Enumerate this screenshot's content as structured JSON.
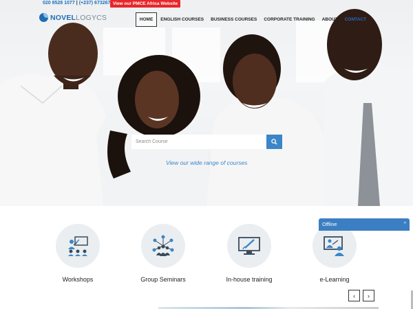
{
  "topbar": {
    "phone1": "020 8528 1077",
    "phone2": "(+237) 673267414",
    "pmce_link": "View our PMCE Africa Website"
  },
  "logo": {
    "part1": "NOVEL",
    "part2": "LOGYCS"
  },
  "nav": {
    "items": [
      "HOME",
      "ENGLISH COURSES",
      "BUSINESS COURSES",
      "CORPORATE TRAINING",
      "ABOUT",
      "CONTACT"
    ],
    "active": "HOME"
  },
  "search": {
    "placeholder": "Search Course",
    "tagline": "View our wide range of courses"
  },
  "features": [
    {
      "label": "Workshops",
      "icon": "workshop-presentation-icon"
    },
    {
      "label": "Group Seminars",
      "icon": "group-network-icon"
    },
    {
      "label": "In-house training",
      "icon": "monitor-pen-icon"
    },
    {
      "label": "e-Learning",
      "icon": "online-teacher-icon"
    }
  ],
  "carousel": {
    "prev": "‹",
    "next": "›"
  },
  "chat_widget": {
    "status": "Offline",
    "chevron": "^"
  },
  "colors": {
    "brand_blue": "#1e6db5",
    "accent_blue": "#3b86c6",
    "pmce_red": "#e8262b",
    "icon_circle": "#eaeef1"
  }
}
